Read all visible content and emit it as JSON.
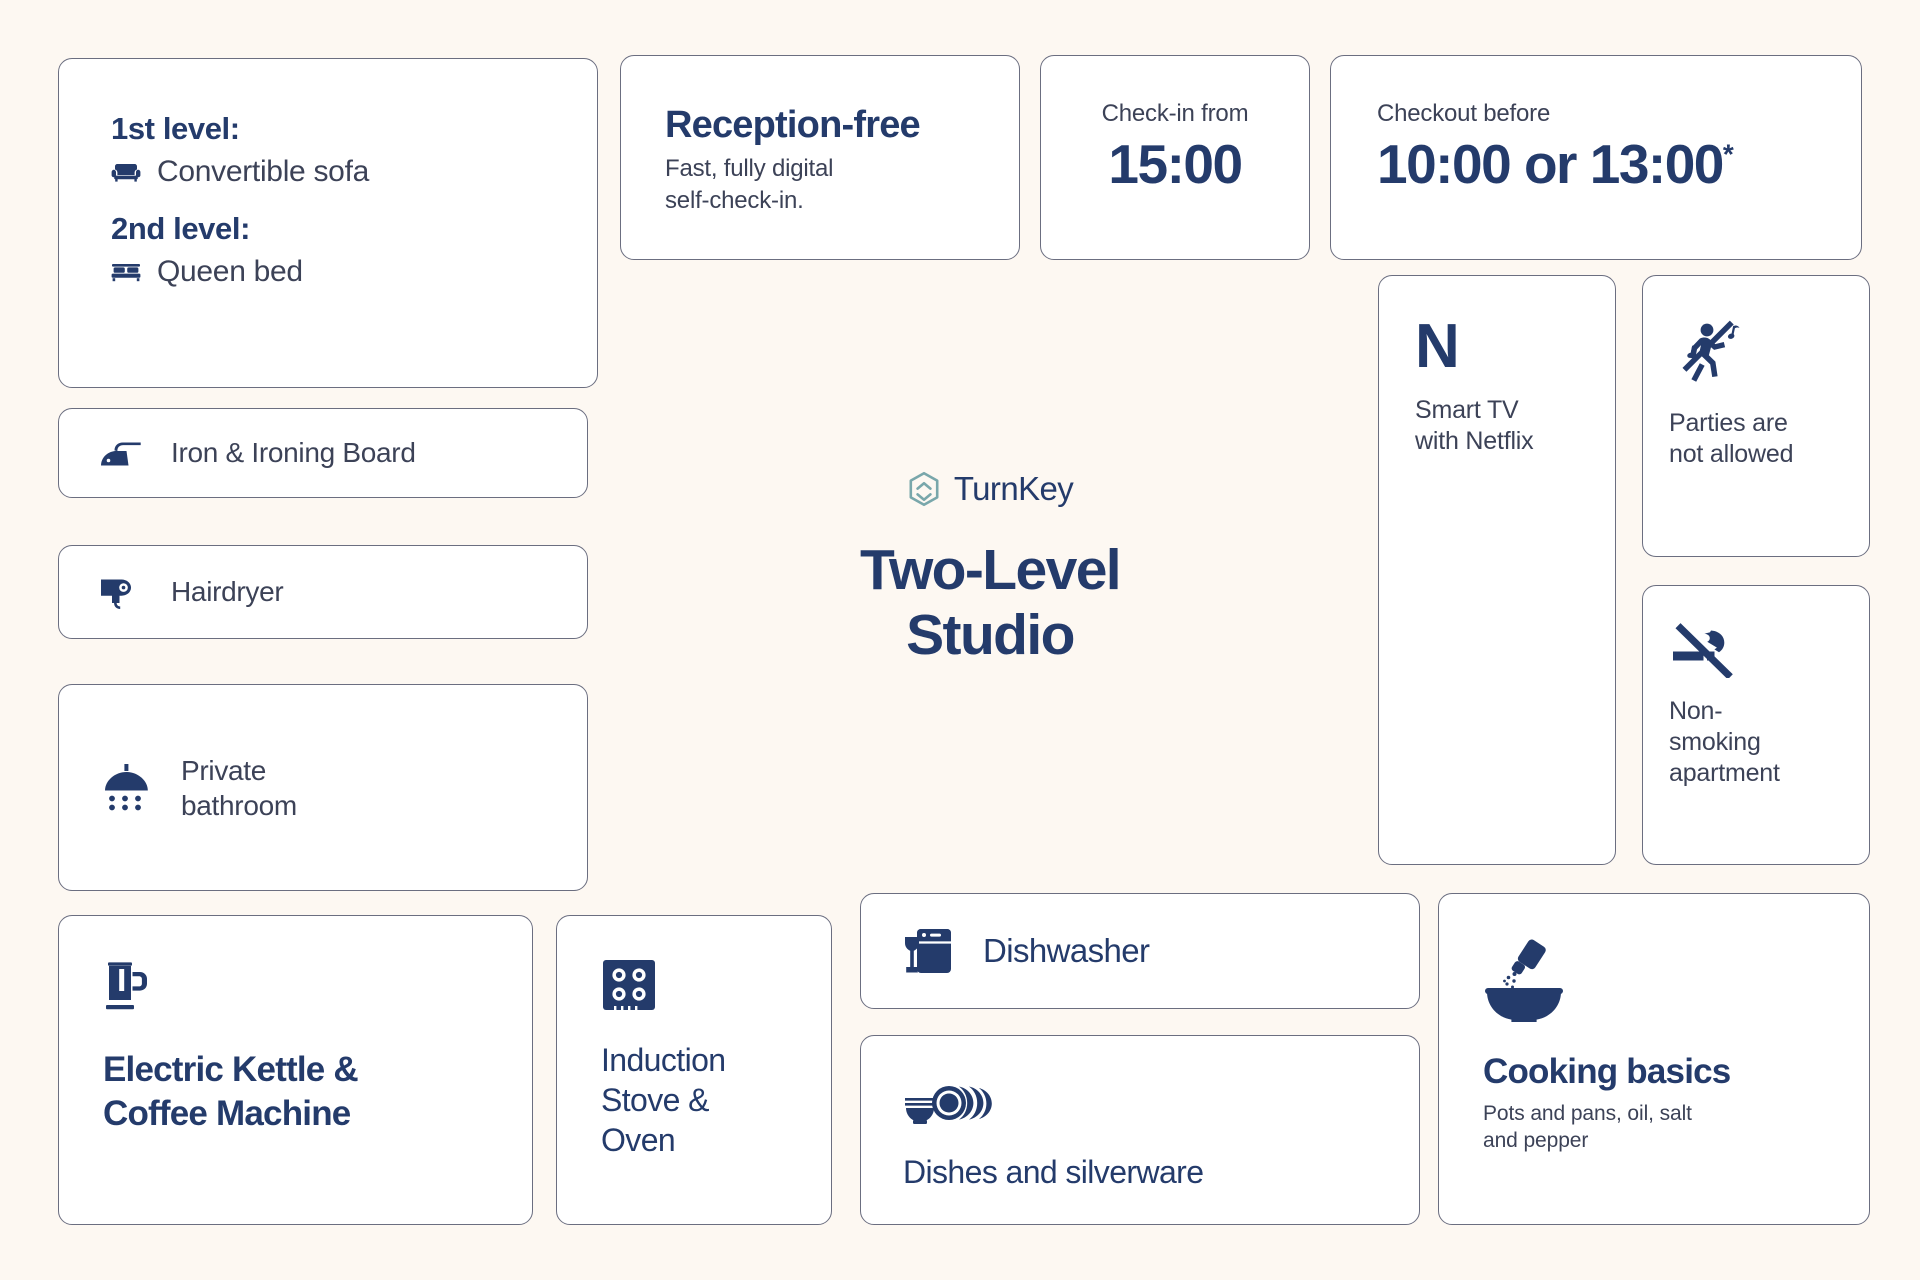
{
  "brand": {
    "logo_icon": "turnkey-hexagon-logo",
    "name": "TurnKey",
    "accent_color": "#6FA3A8",
    "title_line1": "Two-Level",
    "title_line2": "Studio"
  },
  "theme": {
    "background": "#FDF8F2",
    "card_background": "#FFFFFF",
    "navy": "#243B6B",
    "slate": "#3C4257",
    "border": "#6B6E80"
  },
  "levels": {
    "first": {
      "heading": "1st level:",
      "icon": "sofa-icon",
      "item": "Convertible sofa"
    },
    "second": {
      "heading": "2nd level:",
      "icon": "bed-icon",
      "item": "Queen bed"
    }
  },
  "amenities": {
    "iron": {
      "icon": "iron-icon",
      "label": "Iron & Ironing Board"
    },
    "hairdryer": {
      "icon": "hairdryer-icon",
      "label": "Hairdryer"
    },
    "bathroom": {
      "icon": "shower-icon",
      "label_line1": "Private",
      "label_line2": "bathroom"
    }
  },
  "reception": {
    "title": "Reception-free",
    "sub_line1": "Fast, fully digital",
    "sub_line2": "self-check-in."
  },
  "checkin": {
    "label": "Check-in from",
    "value": "15:00"
  },
  "checkout": {
    "label": "Checkout before",
    "value": "10:00 or 13:00",
    "footnote_marker": "*"
  },
  "rules": {
    "tv": {
      "icon": "netflix-n-icon",
      "glyph": "N",
      "label_line1": "Smart TV",
      "label_line2": "with Netflix"
    },
    "parties": {
      "icon": "no-parties-icon",
      "label_line1": "Parties are",
      "label_line2": "not allowed"
    },
    "smoking": {
      "icon": "no-smoking-icon",
      "label_line1": "Non-",
      "label_line2": "smoking",
      "label_line3": "apartment"
    }
  },
  "kitchen": {
    "kettle": {
      "icon": "kettle-icon",
      "title_line1": "Electric Kettle &",
      "title_line2": "Coffee Machine"
    },
    "induction": {
      "icon": "induction-stove-icon",
      "title_line1": "Induction",
      "title_line2": "Stove &",
      "title_line3": "Oven"
    },
    "dishwasher": {
      "icon": "dishwasher-icon",
      "label": "Dishwasher"
    },
    "dishes": {
      "icon": "dishes-icon",
      "label": "Dishes and silverware"
    },
    "cooking": {
      "icon": "mortar-salt-icon",
      "title": "Cooking basics",
      "sub_line1": "Pots and pans, oil, salt",
      "sub_line2": "and pepper"
    }
  }
}
